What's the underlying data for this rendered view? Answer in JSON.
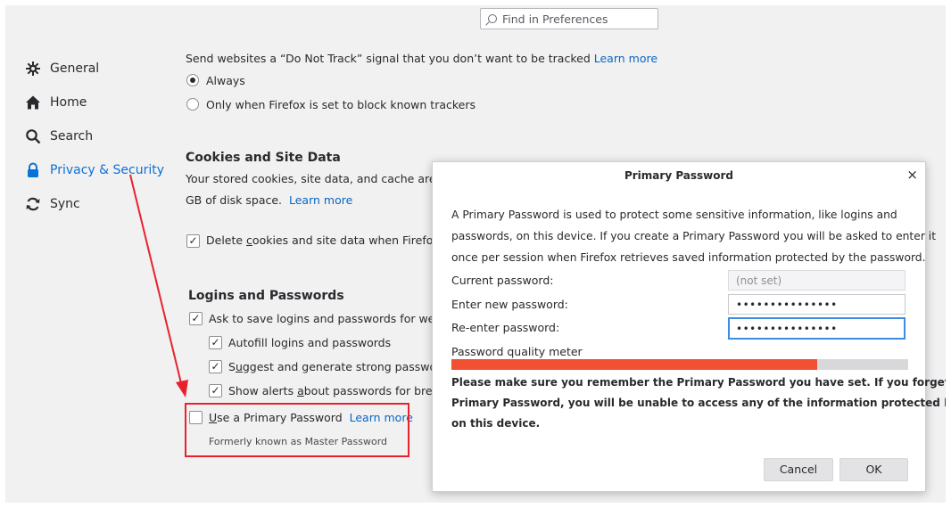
{
  "search": {
    "placeholder": "Find in Preferences"
  },
  "sidebar": {
    "items": [
      {
        "label": "General",
        "icon": "gear-icon"
      },
      {
        "label": "Home",
        "icon": "home-icon"
      },
      {
        "label": "Search",
        "icon": "search-icon"
      },
      {
        "label": "Privacy & Security",
        "icon": "lock-icon",
        "active": true
      },
      {
        "label": "Sync",
        "icon": "sync-icon"
      }
    ]
  },
  "dnt": {
    "text": "Send websites a “Do Not Track” signal that you don’t want to be tracked",
    "learn_more": "Learn more",
    "option_always": "Always",
    "option_known": "Only when Firefox is set to block known trackers"
  },
  "cookies": {
    "heading": "Cookies and Site Data",
    "line1": "Your stored cookies, site data, and cache are cu",
    "line2": "GB of disk space.",
    "learn_more": "Learn more",
    "delete_prefix": "Delete ",
    "delete_u": "c",
    "delete_suffix": "ookies and site data when Firefox i"
  },
  "logins": {
    "heading": "Logins and Passwords",
    "ask_save": "Ask to save logins and passwords for websi",
    "autofill_a": "Autof",
    "autofill_u": "i",
    "autofill_b": "ll logins and passwords",
    "suggest_a": "S",
    "suggest_u": "u",
    "suggest_b": "ggest and generate strong password",
    "alerts_a": "Show alerts ",
    "alerts_u": "a",
    "alerts_b": "bout passwords for breac",
    "primary_a": "",
    "primary_u": "U",
    "primary_b": "se a Primary Password",
    "primary_learn_more": "Learn more",
    "formerly": "Formerly known as Master Password"
  },
  "dialog": {
    "title": "Primary Password",
    "close": "×",
    "desc1": "A Primary Password is used to protect some sensitive information, like logins and",
    "desc2": "passwords, on this device. If you create a Primary Password you will be asked to enter it",
    "desc3": "once per session when Firefox retrieves saved information protected by the password.",
    "current_label": "Current password:",
    "current_value": "(not set)",
    "new_label": "Enter new password:",
    "new_value": "•••••••••••••••",
    "reenter_label": "Re-enter password:",
    "reenter_value": "•••••••••••••••",
    "meter_label": "Password quality meter",
    "meter_fraction": 0.8,
    "warn1": "Please make sure you remember the Primary Password you have set. If you forget your",
    "warn2": "Primary Password, you will be unable to access any of the information protected by it",
    "warn3": "on this device.",
    "cancel": "Cancel",
    "ok": "OK"
  },
  "colors": {
    "accent": "#0a72d6",
    "annotation_red": "#e8222d",
    "meter_fill": "#f25033"
  }
}
